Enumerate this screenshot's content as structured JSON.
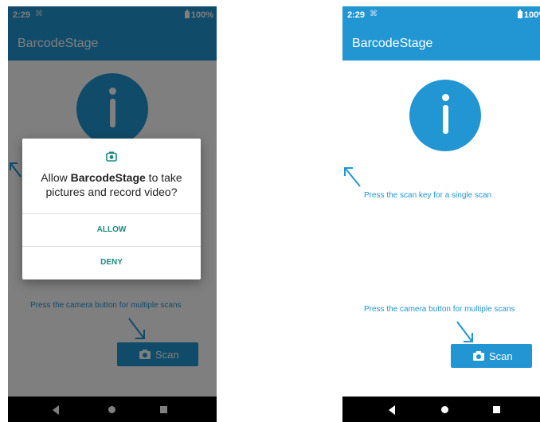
{
  "status_bar": {
    "time": "2:29",
    "battery": "100%"
  },
  "app": {
    "title": "BarcodeStage"
  },
  "hints": {
    "single_scan": "Press the scan key for a single scan",
    "multi_scan": "Press the camera button for multiple scans"
  },
  "scan_button": {
    "label": "Scan"
  },
  "permission_dialog": {
    "prefix": "Allow ",
    "app_name": "BarcodeStage",
    "suffix_line1": " to take",
    "line2": "pictures and record video?",
    "allow_label": "ALLOW",
    "deny_label": "DENY"
  },
  "colors": {
    "app_bar": "#2196d3",
    "accent": "#2196d3",
    "dialog_button": "#1e8a7d"
  }
}
